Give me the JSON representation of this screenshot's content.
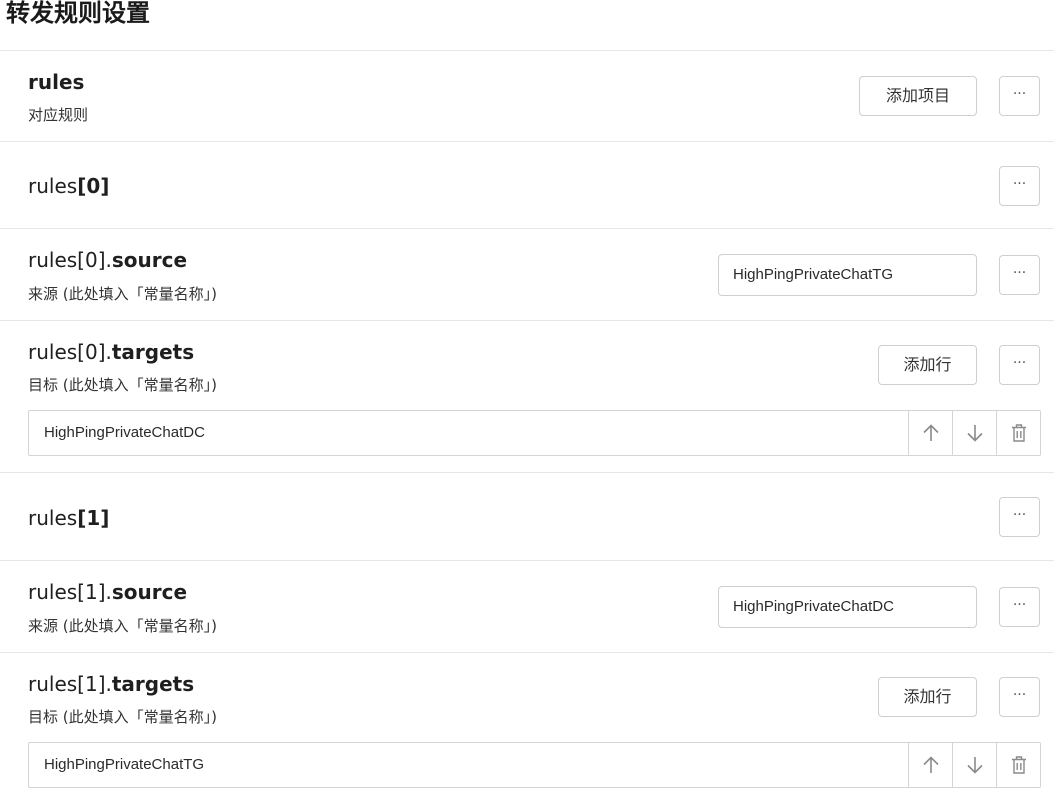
{
  "page": {
    "title": "转发规则设置"
  },
  "rules_block": {
    "title": "rules",
    "description": "对应规则",
    "add_item_label": "添加项目",
    "more_label": "···"
  },
  "rules": [
    {
      "header": {
        "prefix": "rules",
        "index": "[0]",
        "more_label": "···"
      },
      "source": {
        "prefix": "rules[0].",
        "key": "source",
        "description": "来源 (此处填入「常量名称」)",
        "value": "HighPingPrivateChatTG",
        "more_label": "···"
      },
      "targets": {
        "prefix": "rules[0].",
        "key": "targets",
        "description": "目标 (此处填入「常量名称」)",
        "add_row_label": "添加行",
        "more_label": "···",
        "items": [
          "HighPingPrivateChatDC"
        ]
      }
    },
    {
      "header": {
        "prefix": "rules",
        "index": "[1]",
        "more_label": "···"
      },
      "source": {
        "prefix": "rules[1].",
        "key": "source",
        "description": "来源 (此处填入「常量名称」)",
        "value": "HighPingPrivateChatDC",
        "more_label": "···"
      },
      "targets": {
        "prefix": "rules[1].",
        "key": "targets",
        "description": "目标 (此处填入「常量名称」)",
        "add_row_label": "添加行",
        "more_label": "···",
        "items": [
          "HighPingPrivateChatTG"
        ]
      }
    }
  ],
  "icons": {
    "move_up": "arrow-up-icon",
    "move_down": "arrow-down-icon",
    "delete": "trash-icon",
    "more": "ellipsis-icon"
  },
  "colors": {
    "border": "#cfcfcf",
    "divider": "#e6e6e6",
    "icon": "#8a8a8a",
    "text": "#1f1f1f"
  }
}
